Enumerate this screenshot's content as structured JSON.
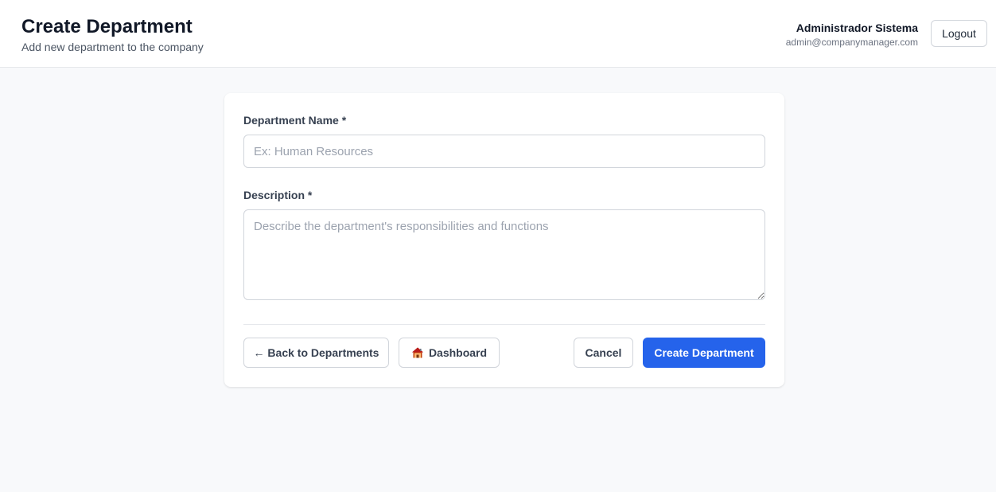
{
  "header": {
    "title": "Create Department",
    "subtitle": "Add new department to the company",
    "user_name": "Administrador Sistema",
    "user_email": "admin@companymanager.com",
    "logout_label": "Logout"
  },
  "form": {
    "name_label": "Department Name *",
    "name_placeholder": "Ex: Human Resources",
    "name_value": "",
    "description_label": "Description *",
    "description_placeholder": "Describe the department's responsibilities and functions",
    "description_value": ""
  },
  "actions": {
    "back_label": "← Back to Departments",
    "dashboard_label": "Dashboard",
    "dashboard_icon": "house-icon",
    "cancel_label": "Cancel",
    "create_label": "Create Department"
  },
  "colors": {
    "primary": "#2563eb",
    "background": "#f8f9fb",
    "border": "#d1d5db"
  }
}
